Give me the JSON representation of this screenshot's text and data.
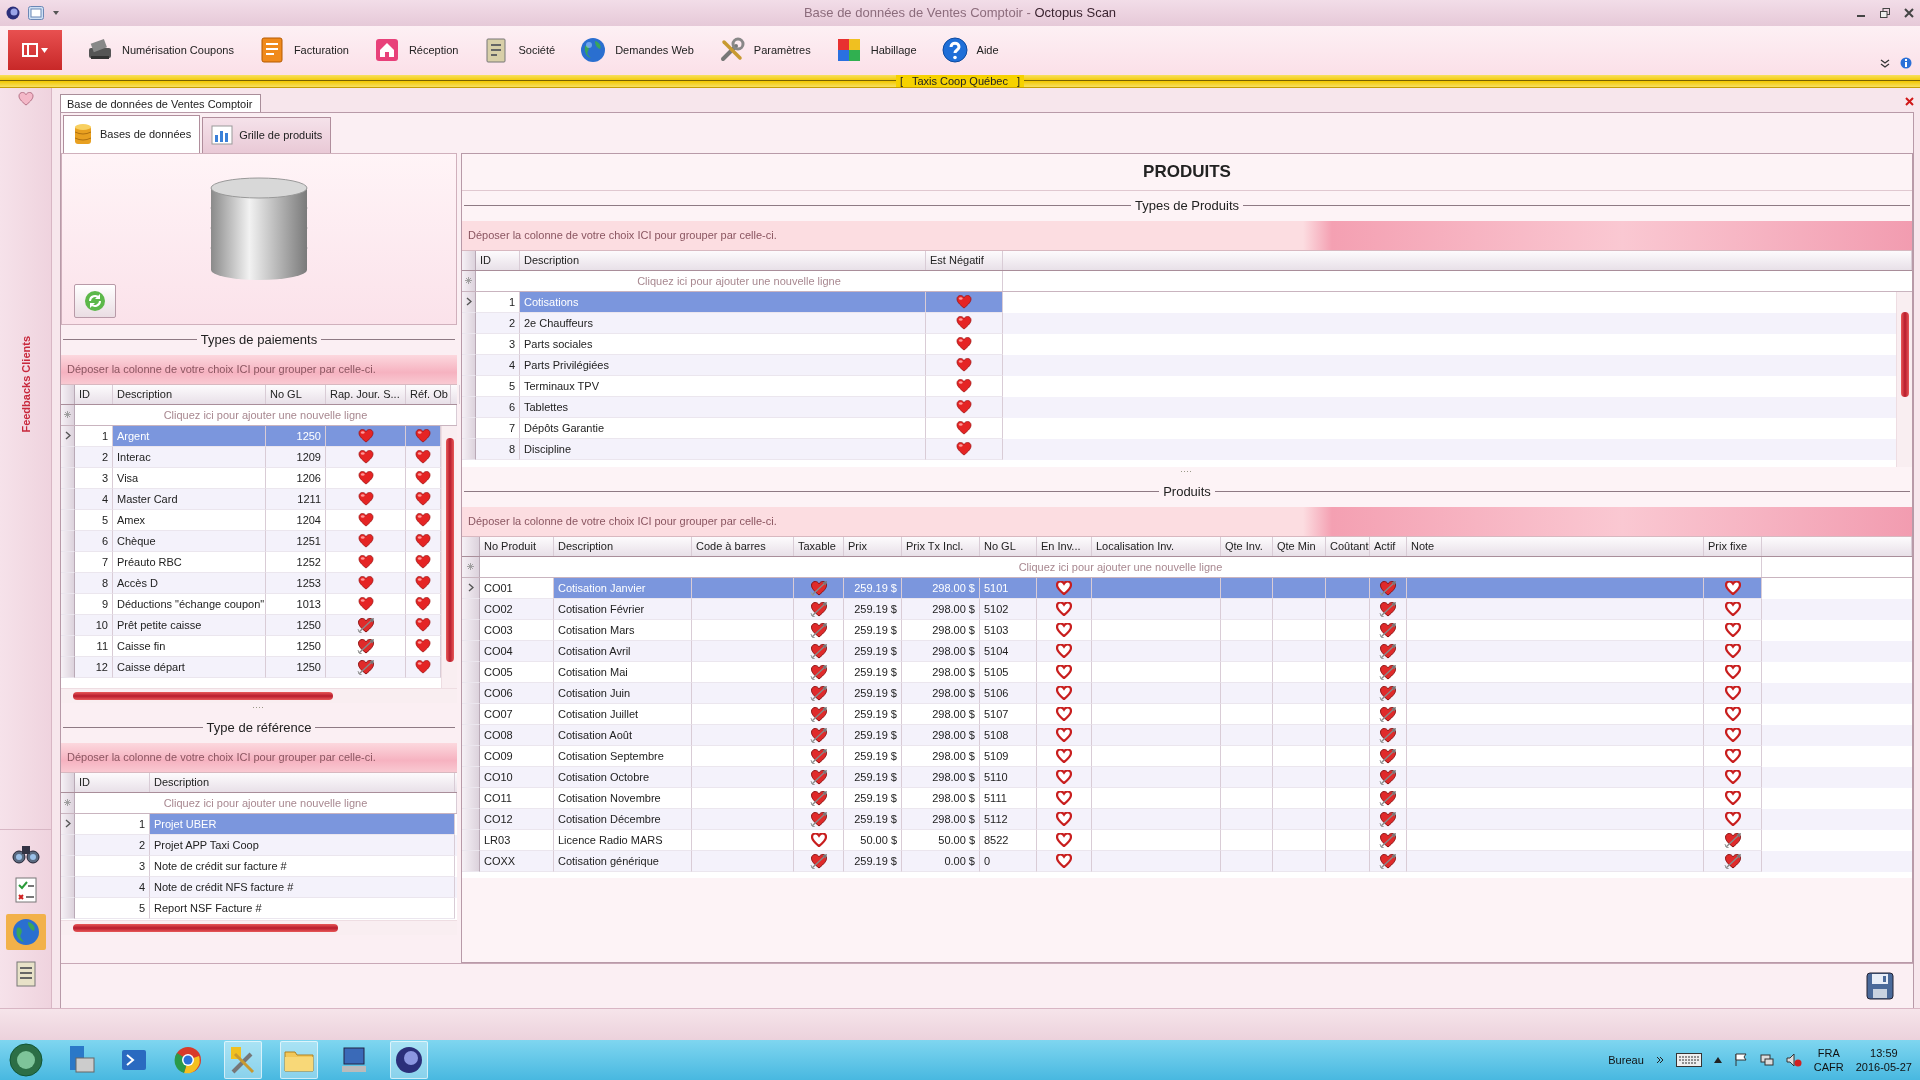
{
  "window": {
    "title": "Base de données de Ventes Comptoir - ",
    "app_name": "Octopus Scan"
  },
  "ribbon": [
    {
      "label": "Numérisation Coupons"
    },
    {
      "label": "Facturation"
    },
    {
      "label": "Réception"
    },
    {
      "label": "Société"
    },
    {
      "label": "Demandes Web"
    },
    {
      "label": "Paramètres"
    },
    {
      "label": "Habillage"
    },
    {
      "label": "Aide"
    }
  ],
  "company_banner": "[   Taxis Coop Québec   ]",
  "side_panel": {
    "label": "Feedbacks Clients"
  },
  "document_tab": {
    "label": "Base de données de Ventes Comptoir"
  },
  "tabs": [
    {
      "label": "Bases de données",
      "selected": true
    },
    {
      "label": "Grille de produits",
      "selected": false
    }
  ],
  "payment_types": {
    "title": "Types de paiements",
    "group_hint": "Déposer la colonne de votre choix ICI pour grouper par celle-ci.",
    "new_row_hint": "Cliquez ici pour ajouter une nouvelle ligne",
    "columns": [
      {
        "label": "ID",
        "kind": "text"
      },
      {
        "label": "Description",
        "kind": "text"
      },
      {
        "label": "No GL",
        "kind": "text"
      },
      {
        "label": "Rap. Jour. S...",
        "kind": "check"
      },
      {
        "label": "Réf. Ob",
        "kind": "check"
      }
    ],
    "rows": [
      {
        "selected": true,
        "cells": [
          "1",
          "Argent",
          "1250",
          false,
          false
        ]
      },
      {
        "selected": false,
        "cells": [
          "2",
          "Interac",
          "1209",
          false,
          false
        ]
      },
      {
        "selected": false,
        "cells": [
          "3",
          "Visa",
          "1206",
          false,
          false
        ]
      },
      {
        "selected": false,
        "cells": [
          "4",
          "Master Card",
          "1211",
          false,
          false
        ]
      },
      {
        "selected": false,
        "cells": [
          "5",
          "Amex",
          "1204",
          false,
          false
        ]
      },
      {
        "selected": false,
        "cells": [
          "6",
          "Chèque",
          "1251",
          false,
          false
        ]
      },
      {
        "selected": false,
        "cells": [
          "7",
          "Préauto RBC",
          "1252",
          false,
          false
        ]
      },
      {
        "selected": false,
        "cells": [
          "8",
          "Accès D",
          "1253",
          false,
          false
        ]
      },
      {
        "selected": false,
        "cells": [
          "9",
          "Déductions \"échange coupon\"",
          "1013",
          false,
          false
        ]
      },
      {
        "selected": false,
        "cells": [
          "10",
          "Prêt petite caisse",
          "1250",
          true,
          false
        ]
      },
      {
        "selected": false,
        "cells": [
          "11",
          "Caisse fin",
          "1250",
          true,
          false
        ]
      },
      {
        "selected": false,
        "cells": [
          "12",
          "Caisse départ",
          "1250",
          true,
          false
        ]
      }
    ]
  },
  "reference_types": {
    "title": "Type de référence",
    "group_hint": "Déposer la colonne de votre choix ICI pour grouper par celle-ci.",
    "new_row_hint": "Cliquez ici pour ajouter une nouvelle ligne",
    "columns": [
      {
        "label": "ID",
        "kind": "text"
      },
      {
        "label": "Description",
        "kind": "text"
      }
    ],
    "rows": [
      {
        "selected": true,
        "cells": [
          "1",
          "Projet UBER"
        ]
      },
      {
        "selected": false,
        "cells": [
          "2",
          "Projet APP Taxi Coop"
        ]
      },
      {
        "selected": false,
        "cells": [
          "3",
          "Note de crédit sur facture #"
        ]
      },
      {
        "selected": false,
        "cells": [
          "4",
          "Note de crédit NFS facture #"
        ]
      },
      {
        "selected": false,
        "cells": [
          "5",
          "Report NSF Facture #"
        ]
      }
    ]
  },
  "heading": "PRODUITS",
  "product_types": {
    "title": "Types de Produits",
    "group_hint": "Déposer la colonne de votre choix ICI pour grouper par celle-ci.",
    "new_row_hint": "Cliquez ici pour ajouter une nouvelle ligne",
    "columns": [
      {
        "label": "ID",
        "kind": "text"
      },
      {
        "label": "Description",
        "kind": "text"
      },
      {
        "label": "Est Négatif",
        "kind": "check"
      }
    ],
    "rows": [
      {
        "selected": true,
        "cells": [
          "1",
          "Cotisations",
          false
        ]
      },
      {
        "selected": false,
        "cells": [
          "2",
          "2e Chauffeurs",
          false
        ]
      },
      {
        "selected": false,
        "cells": [
          "3",
          "Parts sociales",
          false
        ]
      },
      {
        "selected": false,
        "cells": [
          "4",
          "Parts Privilégiées",
          false
        ]
      },
      {
        "selected": false,
        "cells": [
          "5",
          "Terminaux TPV",
          false
        ]
      },
      {
        "selected": false,
        "cells": [
          "6",
          "Tablettes",
          false
        ]
      },
      {
        "selected": false,
        "cells": [
          "7",
          "Dépôts Garantie",
          false
        ]
      },
      {
        "selected": false,
        "cells": [
          "8",
          "Discipline",
          false
        ]
      }
    ]
  },
  "products": {
    "title": "Produits",
    "group_hint": "Déposer la colonne de votre choix ICI pour grouper par celle-ci.",
    "new_row_hint": "Cliquez ici pour ajouter une nouvelle ligne",
    "columns": [
      {
        "label": "No Produit",
        "kind": "text"
      },
      {
        "label": "Description",
        "kind": "text"
      },
      {
        "label": "Code à barres",
        "kind": "text"
      },
      {
        "label": "Taxable",
        "kind": "toggle"
      },
      {
        "label": "Prix",
        "kind": "text"
      },
      {
        "label": "Prix Tx Incl.",
        "kind": "text"
      },
      {
        "label": "No GL",
        "kind": "text"
      },
      {
        "label": "En Inv...",
        "kind": "toggle"
      },
      {
        "label": "Localisation Inv.",
        "kind": "text"
      },
      {
        "label": "Qte Inv.",
        "kind": "text"
      },
      {
        "label": "Qte Min",
        "kind": "text"
      },
      {
        "label": "Coûtant",
        "kind": "text"
      },
      {
        "label": "Actif",
        "kind": "toggle"
      },
      {
        "label": "Note",
        "kind": "text"
      },
      {
        "label": "Prix fixe",
        "kind": "toggle"
      }
    ],
    "rows": [
      {
        "selected": true,
        "cells": [
          "CO01",
          "Cotisation Janvier",
          null,
          true,
          "259.19 $",
          "298.00 $",
          "5101",
          false,
          null,
          null,
          null,
          null,
          true,
          null,
          false
        ]
      },
      {
        "selected": false,
        "cells": [
          "CO02",
          "Cotisation Février",
          null,
          true,
          "259.19 $",
          "298.00 $",
          "5102",
          false,
          null,
          null,
          null,
          null,
          true,
          null,
          false
        ]
      },
      {
        "selected": false,
        "cells": [
          "CO03",
          "Cotisation Mars",
          null,
          true,
          "259.19 $",
          "298.00 $",
          "5103",
          false,
          null,
          null,
          null,
          null,
          true,
          null,
          false
        ]
      },
      {
        "selected": false,
        "cells": [
          "CO04",
          "Cotisation Avril",
          null,
          true,
          "259.19 $",
          "298.00 $",
          "5104",
          false,
          null,
          null,
          null,
          null,
          true,
          null,
          false
        ]
      },
      {
        "selected": false,
        "cells": [
          "CO05",
          "Cotisation Mai",
          null,
          true,
          "259.19 $",
          "298.00 $",
          "5105",
          false,
          null,
          null,
          null,
          null,
          true,
          null,
          false
        ]
      },
      {
        "selected": false,
        "cells": [
          "CO06",
          "Cotisation Juin",
          null,
          true,
          "259.19 $",
          "298.00 $",
          "5106",
          false,
          null,
          null,
          null,
          null,
          true,
          null,
          false
        ]
      },
      {
        "selected": false,
        "cells": [
          "CO07",
          "Cotisation Juillet",
          null,
          true,
          "259.19 $",
          "298.00 $",
          "5107",
          false,
          null,
          null,
          null,
          null,
          true,
          null,
          false
        ]
      },
      {
        "selected": false,
        "cells": [
          "CO08",
          "Cotisation Août",
          null,
          true,
          "259.19 $",
          "298.00 $",
          "5108",
          false,
          null,
          null,
          null,
          null,
          true,
          null,
          false
        ]
      },
      {
        "selected": false,
        "cells": [
          "CO09",
          "Cotisation Septembre",
          null,
          true,
          "259.19 $",
          "298.00 $",
          "5109",
          false,
          null,
          null,
          null,
          null,
          true,
          null,
          false
        ]
      },
      {
        "selected": false,
        "cells": [
          "CO10",
          "Cotisation Octobre",
          null,
          true,
          "259.19 $",
          "298.00 $",
          "5110",
          false,
          null,
          null,
          null,
          null,
          true,
          null,
          false
        ]
      },
      {
        "selected": false,
        "cells": [
          "CO11",
          "Cotisation Novembre",
          null,
          true,
          "259.19 $",
          "298.00 $",
          "5111",
          false,
          null,
          null,
          null,
          null,
          true,
          null,
          false
        ]
      },
      {
        "selected": false,
        "cells": [
          "CO12",
          "Cotisation Décembre",
          null,
          true,
          "259.19 $",
          "298.00 $",
          "5112",
          false,
          null,
          null,
          null,
          null,
          true,
          null,
          false
        ]
      },
      {
        "selected": false,
        "cells": [
          "LR03",
          "Licence Radio MARS",
          null,
          false,
          "50.00 $",
          "50.00 $",
          "8522",
          false,
          null,
          null,
          null,
          null,
          true,
          null,
          true
        ]
      },
      {
        "selected": false,
        "cells": [
          "COXX",
          "Cotisation générique",
          null,
          true,
          "259.19 $",
          "0.00 $",
          "0",
          false,
          null,
          null,
          null,
          null,
          true,
          null,
          true
        ]
      }
    ]
  },
  "taskbar": {
    "toolbar": "Bureau",
    "language": "FRA",
    "keyboard_layout": "CAFR",
    "time": "13:59",
    "date": "2016-05-27"
  }
}
